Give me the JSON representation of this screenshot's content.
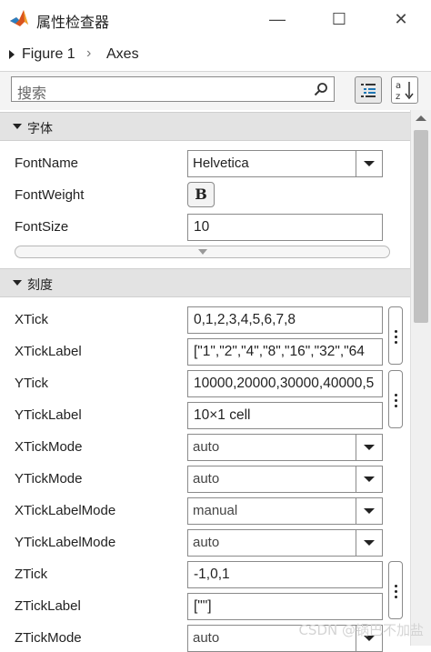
{
  "window": {
    "title": "属性检查器",
    "buttons": {
      "minimize": "—",
      "maximize": "☐",
      "close": "✕"
    }
  },
  "breadcrumb": {
    "items": [
      "Figure 1",
      "Axes"
    ]
  },
  "search": {
    "placeholder": "搜索"
  },
  "sections": [
    {
      "label": "字体",
      "properties": [
        {
          "name": "FontName",
          "value": "Helvetica",
          "control": "dropdown"
        },
        {
          "name": "FontWeight",
          "value": "B",
          "control": "toggle"
        },
        {
          "name": "FontSize",
          "value": "10",
          "control": "text"
        }
      ]
    },
    {
      "label": "刻度",
      "properties": [
        {
          "name": "XTick",
          "value": "0,1,2,3,4,5,6,7,8",
          "control": "text"
        },
        {
          "name": "XTickLabel",
          "value": "[\"1\",\"2\",\"4\",\"8\",\"16\",\"32\",\"64",
          "control": "text"
        },
        {
          "name": "YTick",
          "value": "10000,20000,30000,40000,5",
          "control": "text"
        },
        {
          "name": "YTickLabel",
          "value": "10×1 cell",
          "control": "text"
        },
        {
          "name": "XTickMode",
          "value": "auto",
          "control": "dropdown"
        },
        {
          "name": "YTickMode",
          "value": "auto",
          "control": "dropdown"
        },
        {
          "name": "XTickLabelMode",
          "value": "manual",
          "control": "dropdown"
        },
        {
          "name": "YTickLabelMode",
          "value": "auto",
          "control": "dropdown"
        },
        {
          "name": "ZTick",
          "value": "-1,0,1",
          "control": "text"
        },
        {
          "name": "ZTickLabel",
          "value": "[\"\"]",
          "control": "text"
        },
        {
          "name": "ZTickMode",
          "value": "auto",
          "control": "dropdown"
        }
      ]
    }
  ],
  "watermark": "CSDN @锅巴不加盐",
  "icons": {
    "logo": "matlab-logo-icon",
    "search": "search-icon",
    "group_view": "group-view-icon",
    "sort_view": "sort-alphabetical-icon"
  },
  "colors": {
    "section_bg": "#e3e3e3",
    "accent": "#1f77b4"
  }
}
